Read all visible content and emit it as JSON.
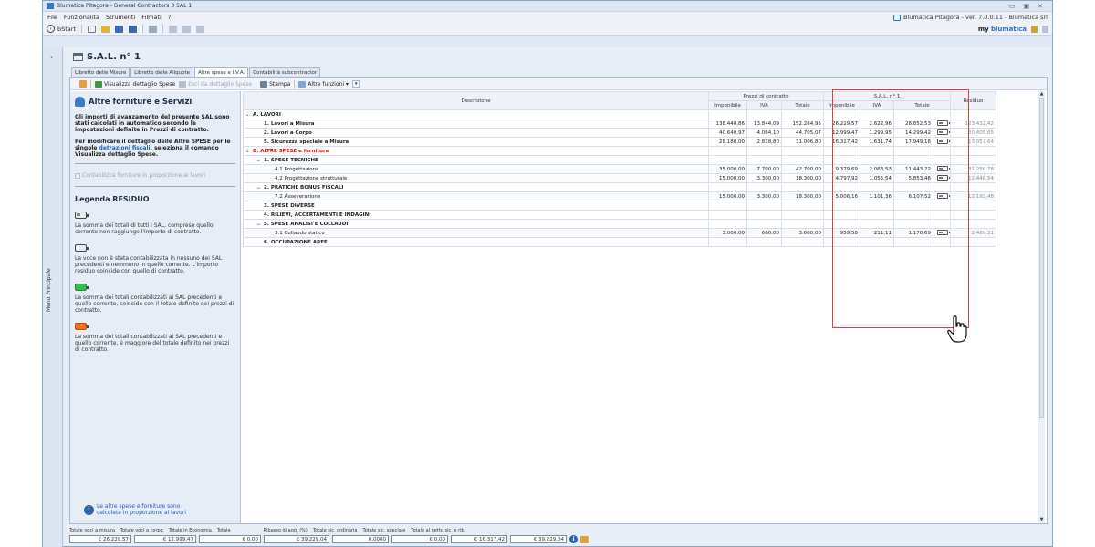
{
  "window": {
    "title": "Blumatica Pitagora - General Contractors 3 SAL 1",
    "controls": [
      "▭",
      "▣",
      "✕"
    ]
  },
  "menu": {
    "items": [
      "File",
      "Funzionalità",
      "Strumenti",
      "Filmati",
      "?"
    ],
    "version": "Blumatica Pitagora - ver. 7.0.0.11 - Blumatica srl"
  },
  "toolbar": {
    "bstart": "bStart",
    "brand_prefix": "my",
    "brand": "blumatica"
  },
  "side": {
    "label": "Menu Principale",
    "chevron": "›"
  },
  "document": {
    "title": "S.A.L. n° 1",
    "tabs": [
      "Libretto delle Misure",
      "Libretto delle Aliquote",
      "Altre spese e I.V.A.",
      "Contabilità subcontractor"
    ],
    "active_tab": 2
  },
  "actions": {
    "visualizza": "Visualizza dettaglio Spese",
    "esci": "Esci da dettaglio Spese",
    "stampa": "Stampa",
    "altre": "Altre funzioni ▾"
  },
  "left_panel": {
    "title": "Altre forniture e Servizi",
    "p1": "Gli importi di avanzamento del presente SAL sono stati calcolati in automatico secondo le impostazioni definite in Prezzi di contratto.",
    "p2_a": "Per modificare il dettaglio delle Altre SPESE per le singole ",
    "p2_link": "detrazioni fiscali",
    "p2_b": ", seleziona il comando Visualizza dettaglio Spese.",
    "checkbox": "Contabilizza forniture in proporzione ai lavori",
    "legend_title": "Legenda RESIDUO",
    "legend": [
      {
        "icon": "battery-partial-icon",
        "text": "La somma dei totali di tutti i SAL, compreso quello corrente non raggiunge l'importo di contratto."
      },
      {
        "icon": "battery-empty-icon",
        "text": "La voce non è stata contabilizzata in nessuno dei SAL precedenti e nemmeno in quello corrente. L'importo residuo coincide con quello di contratto."
      },
      {
        "icon": "battery-green-icon",
        "text": "La somma dei totali contabilizzati ai SAL precedenti e quello corrente, coincide con il totale definito nei prezzi di contratto."
      },
      {
        "icon": "battery-orange-icon",
        "text": "La somma dei totali contabilizzati ai SAL precedenti e quello corrente, è maggiore del totale definito nei prezzi di contratto."
      }
    ],
    "info": "Le altre spese e forniture sono calcolate in proporzione ai lavori"
  },
  "table": {
    "headers": {
      "descrizione": "Descrizione",
      "prezzi": "Prezzi di contratto",
      "sal": "S.A.L. n° 1",
      "residuo": "Residuo",
      "imponibile": "Imponibile",
      "iva": "IVA",
      "totale": "Totale"
    },
    "rows": [
      {
        "type": "grp",
        "level": 0,
        "caret": "⌄",
        "desc": "A. LAVORI",
        "red": false,
        "p_imp": "",
        "p_iva": "",
        "p_tot": "",
        "s_imp": "",
        "s_iva": "",
        "s_tot": "",
        "batt": false,
        "res": ""
      },
      {
        "type": "grp",
        "level": 1,
        "caret": "",
        "desc": "1. Lavori a Misura",
        "red": false,
        "p_imp": "138.440,86",
        "p_iva": "13.844,09",
        "p_tot": "152.284,95",
        "s_imp": "26.229,57",
        "s_iva": "2.622,96",
        "s_tot": "28.852,53",
        "batt": true,
        "res": "123.432,42"
      },
      {
        "type": "grp",
        "level": 1,
        "caret": "",
        "desc": "2. Lavori a Corpo",
        "red": false,
        "p_imp": "40.640,97",
        "p_iva": "4.064,10",
        "p_tot": "44.705,07",
        "s_imp": "12.999,47",
        "s_iva": "1.299,95",
        "s_tot": "14.299,42",
        "batt": true,
        "res": "30.405,65"
      },
      {
        "type": "grp",
        "level": 1,
        "caret": "",
        "desc": "5. Sicurezza speciale a Misura",
        "red": false,
        "p_imp": "28.188,00",
        "p_iva": "2.818,80",
        "p_tot": "31.006,80",
        "s_imp": "16.317,42",
        "s_iva": "1.631,74",
        "s_tot": "17.949,16",
        "batt": true,
        "res": "13.057,64"
      },
      {
        "type": "grp",
        "level": 0,
        "caret": "⌄",
        "desc": "B. ALTRE SPESE e forniture",
        "red": true,
        "p_imp": "",
        "p_iva": "",
        "p_tot": "",
        "s_imp": "",
        "s_iva": "",
        "s_tot": "",
        "batt": false,
        "res": ""
      },
      {
        "type": "grp",
        "level": 1,
        "caret": "⌄",
        "desc": "1. SPESE TECNICHE",
        "red": false,
        "p_imp": "",
        "p_iva": "",
        "p_tot": "",
        "s_imp": "",
        "s_iva": "",
        "s_tot": "",
        "batt": false,
        "res": ""
      },
      {
        "type": "sub",
        "level": 2,
        "caret": "",
        "desc": "4.1 Progettazione",
        "red": false,
        "p_imp": "35.000,00",
        "p_iva": "7.700,00",
        "p_tot": "42.700,00",
        "s_imp": "9.379,69",
        "s_iva": "2.063,53",
        "s_tot": "11.443,22",
        "batt": true,
        "res": "31.256,78"
      },
      {
        "type": "sub",
        "level": 2,
        "caret": "",
        "desc": "4.2 Progettazione strutturale",
        "red": false,
        "p_imp": "15.000,00",
        "p_iva": "3.300,00",
        "p_tot": "18.300,00",
        "s_imp": "4.797,92",
        "s_iva": "1.055,54",
        "s_tot": "5.853,46",
        "batt": true,
        "res": "12.446,54"
      },
      {
        "type": "grp",
        "level": 1,
        "caret": "⌄",
        "desc": "2. PRATICHE BONUS FISCALI",
        "red": false,
        "p_imp": "",
        "p_iva": "",
        "p_tot": "",
        "s_imp": "",
        "s_iva": "",
        "s_tot": "",
        "batt": false,
        "res": ""
      },
      {
        "type": "sub",
        "level": 2,
        "caret": "",
        "desc": "7.2 Asseverazione",
        "red": false,
        "p_imp": "15.000,00",
        "p_iva": "3.300,00",
        "p_tot": "18.300,00",
        "s_imp": "5.006,16",
        "s_iva": "1.101,36",
        "s_tot": "6.107,52",
        "batt": true,
        "res": "12.192,48"
      },
      {
        "type": "grp",
        "level": 1,
        "caret": "",
        "desc": "3. SPESE DIVERSE",
        "red": false,
        "p_imp": "",
        "p_iva": "",
        "p_tot": "",
        "s_imp": "",
        "s_iva": "",
        "s_tot": "",
        "batt": false,
        "res": ""
      },
      {
        "type": "grp",
        "level": 1,
        "caret": "",
        "desc": "4. RILIEVI, ACCERTAMENTI E INDAGINI",
        "red": false,
        "p_imp": "",
        "p_iva": "",
        "p_tot": "",
        "s_imp": "",
        "s_iva": "",
        "s_tot": "",
        "batt": false,
        "res": ""
      },
      {
        "type": "grp",
        "level": 1,
        "caret": "⌄",
        "desc": "5. SPESE ANALISI E COLLAUDI",
        "red": false,
        "p_imp": "",
        "p_iva": "",
        "p_tot": "",
        "s_imp": "",
        "s_iva": "",
        "s_tot": "",
        "batt": false,
        "res": ""
      },
      {
        "type": "sub",
        "level": 2,
        "caret": "",
        "desc": "3.1 Collaudo statico",
        "red": false,
        "p_imp": "3.000,00",
        "p_iva": "660,00",
        "p_tot": "3.660,00",
        "s_imp": "959,58",
        "s_iva": "211,11",
        "s_tot": "1.170,69",
        "batt": true,
        "res": "2.489,31"
      },
      {
        "type": "grp",
        "level": 1,
        "caret": "",
        "desc": "6. OCCUPAZIONE AREE",
        "red": false,
        "p_imp": "",
        "p_iva": "",
        "p_tot": "",
        "s_imp": "",
        "s_iva": "",
        "s_tot": "",
        "batt": false,
        "res": ""
      }
    ]
  },
  "footer": {
    "labels": [
      "Totale voci a misura",
      "Totale voci a corpo",
      "Totale in Economia",
      "Totale",
      "Ribasso di agg. (%)",
      "Totale sic. ordinaria",
      "Totale sic. speciale",
      "Totale al netto sic. e rib."
    ],
    "values": [
      "€ 26.229,57",
      "€ 12.999,47",
      "€ 0,00",
      "€ 39.229,04",
      "0,0000",
      "€ 0,00",
      "€ 16.317,42",
      "€ 39.229,04"
    ]
  },
  "colors": {
    "highlight": "#e0403a",
    "accent": "#2f6fbf",
    "red_text": "#dd1111"
  }
}
